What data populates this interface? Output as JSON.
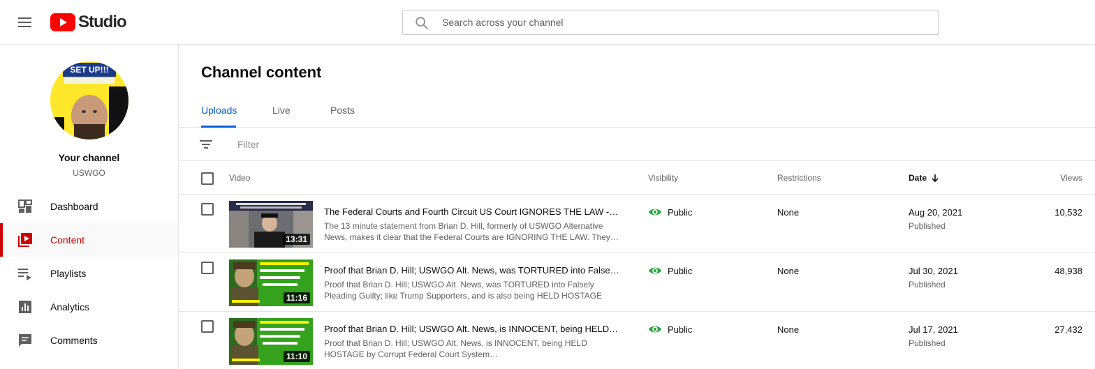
{
  "header": {
    "logo_text": "Studio",
    "search_placeholder": "Search across your channel"
  },
  "sidebar": {
    "channel_title": "Your channel",
    "channel_name": "USWGO",
    "avatar_text": "SET UP!!!",
    "items": [
      {
        "label": "Dashboard",
        "icon": "dashboard-icon",
        "active": false
      },
      {
        "label": "Content",
        "icon": "content-icon",
        "active": true
      },
      {
        "label": "Playlists",
        "icon": "playlists-icon",
        "active": false
      },
      {
        "label": "Analytics",
        "icon": "analytics-icon",
        "active": false
      },
      {
        "label": "Comments",
        "icon": "comments-icon",
        "active": false
      }
    ]
  },
  "main": {
    "title": "Channel content",
    "tabs": [
      {
        "label": "Uploads",
        "active": true
      },
      {
        "label": "Live",
        "active": false
      },
      {
        "label": "Posts",
        "active": false
      }
    ],
    "filter_placeholder": "Filter",
    "columns": {
      "video": "Video",
      "visibility": "Visibility",
      "restrictions": "Restrictions",
      "date": "Date",
      "views": "Views"
    },
    "rows": [
      {
        "title": "The Federal Courts and Fourth Circuit US Court IGNORES THE LAW - Bri…",
        "description": "The 13 minute statement from Brian D. Hill, formerly of USWGO Alternative News, makes it clear that the Federal Courts are IGNORING THE LAW. They…",
        "duration": "13:31",
        "visibility": "Public",
        "restrictions": "None",
        "date": "Aug 20, 2021",
        "date_status": "Published",
        "views": "10,532"
      },
      {
        "title": "Proof that Brian D. Hill; USWGO Alt. News, was TORTURED into Falsely P…",
        "description": "Proof that Brian D. Hill; USWGO Alt. News, was TORTURED into Falsely Pleading Guilty; like Trump Supporters, and is also being HELD HOSTAGE by…",
        "duration": "11:16",
        "visibility": "Public",
        "restrictions": "None",
        "date": "Jul 30, 2021",
        "date_status": "Published",
        "views": "48,938"
      },
      {
        "title": "Proof that Brian D. Hill; USWGO Alt. News, is INNOCENT, being HELD HO…",
        "description": "Proof that Brian D. Hill; USWGO Alt. News, is INNOCENT, being HELD HOSTAGE by Corrupt Federal Court System…",
        "duration": "11:10",
        "visibility": "Public",
        "restrictions": "None",
        "date": "Jul 17, 2021",
        "date_status": "Published",
        "views": "27,432"
      }
    ]
  },
  "colors": {
    "accent_red": "#cc0000",
    "youtube_red": "#ff0000",
    "link_blue": "#065fd4",
    "public_green": "#2ba640"
  }
}
